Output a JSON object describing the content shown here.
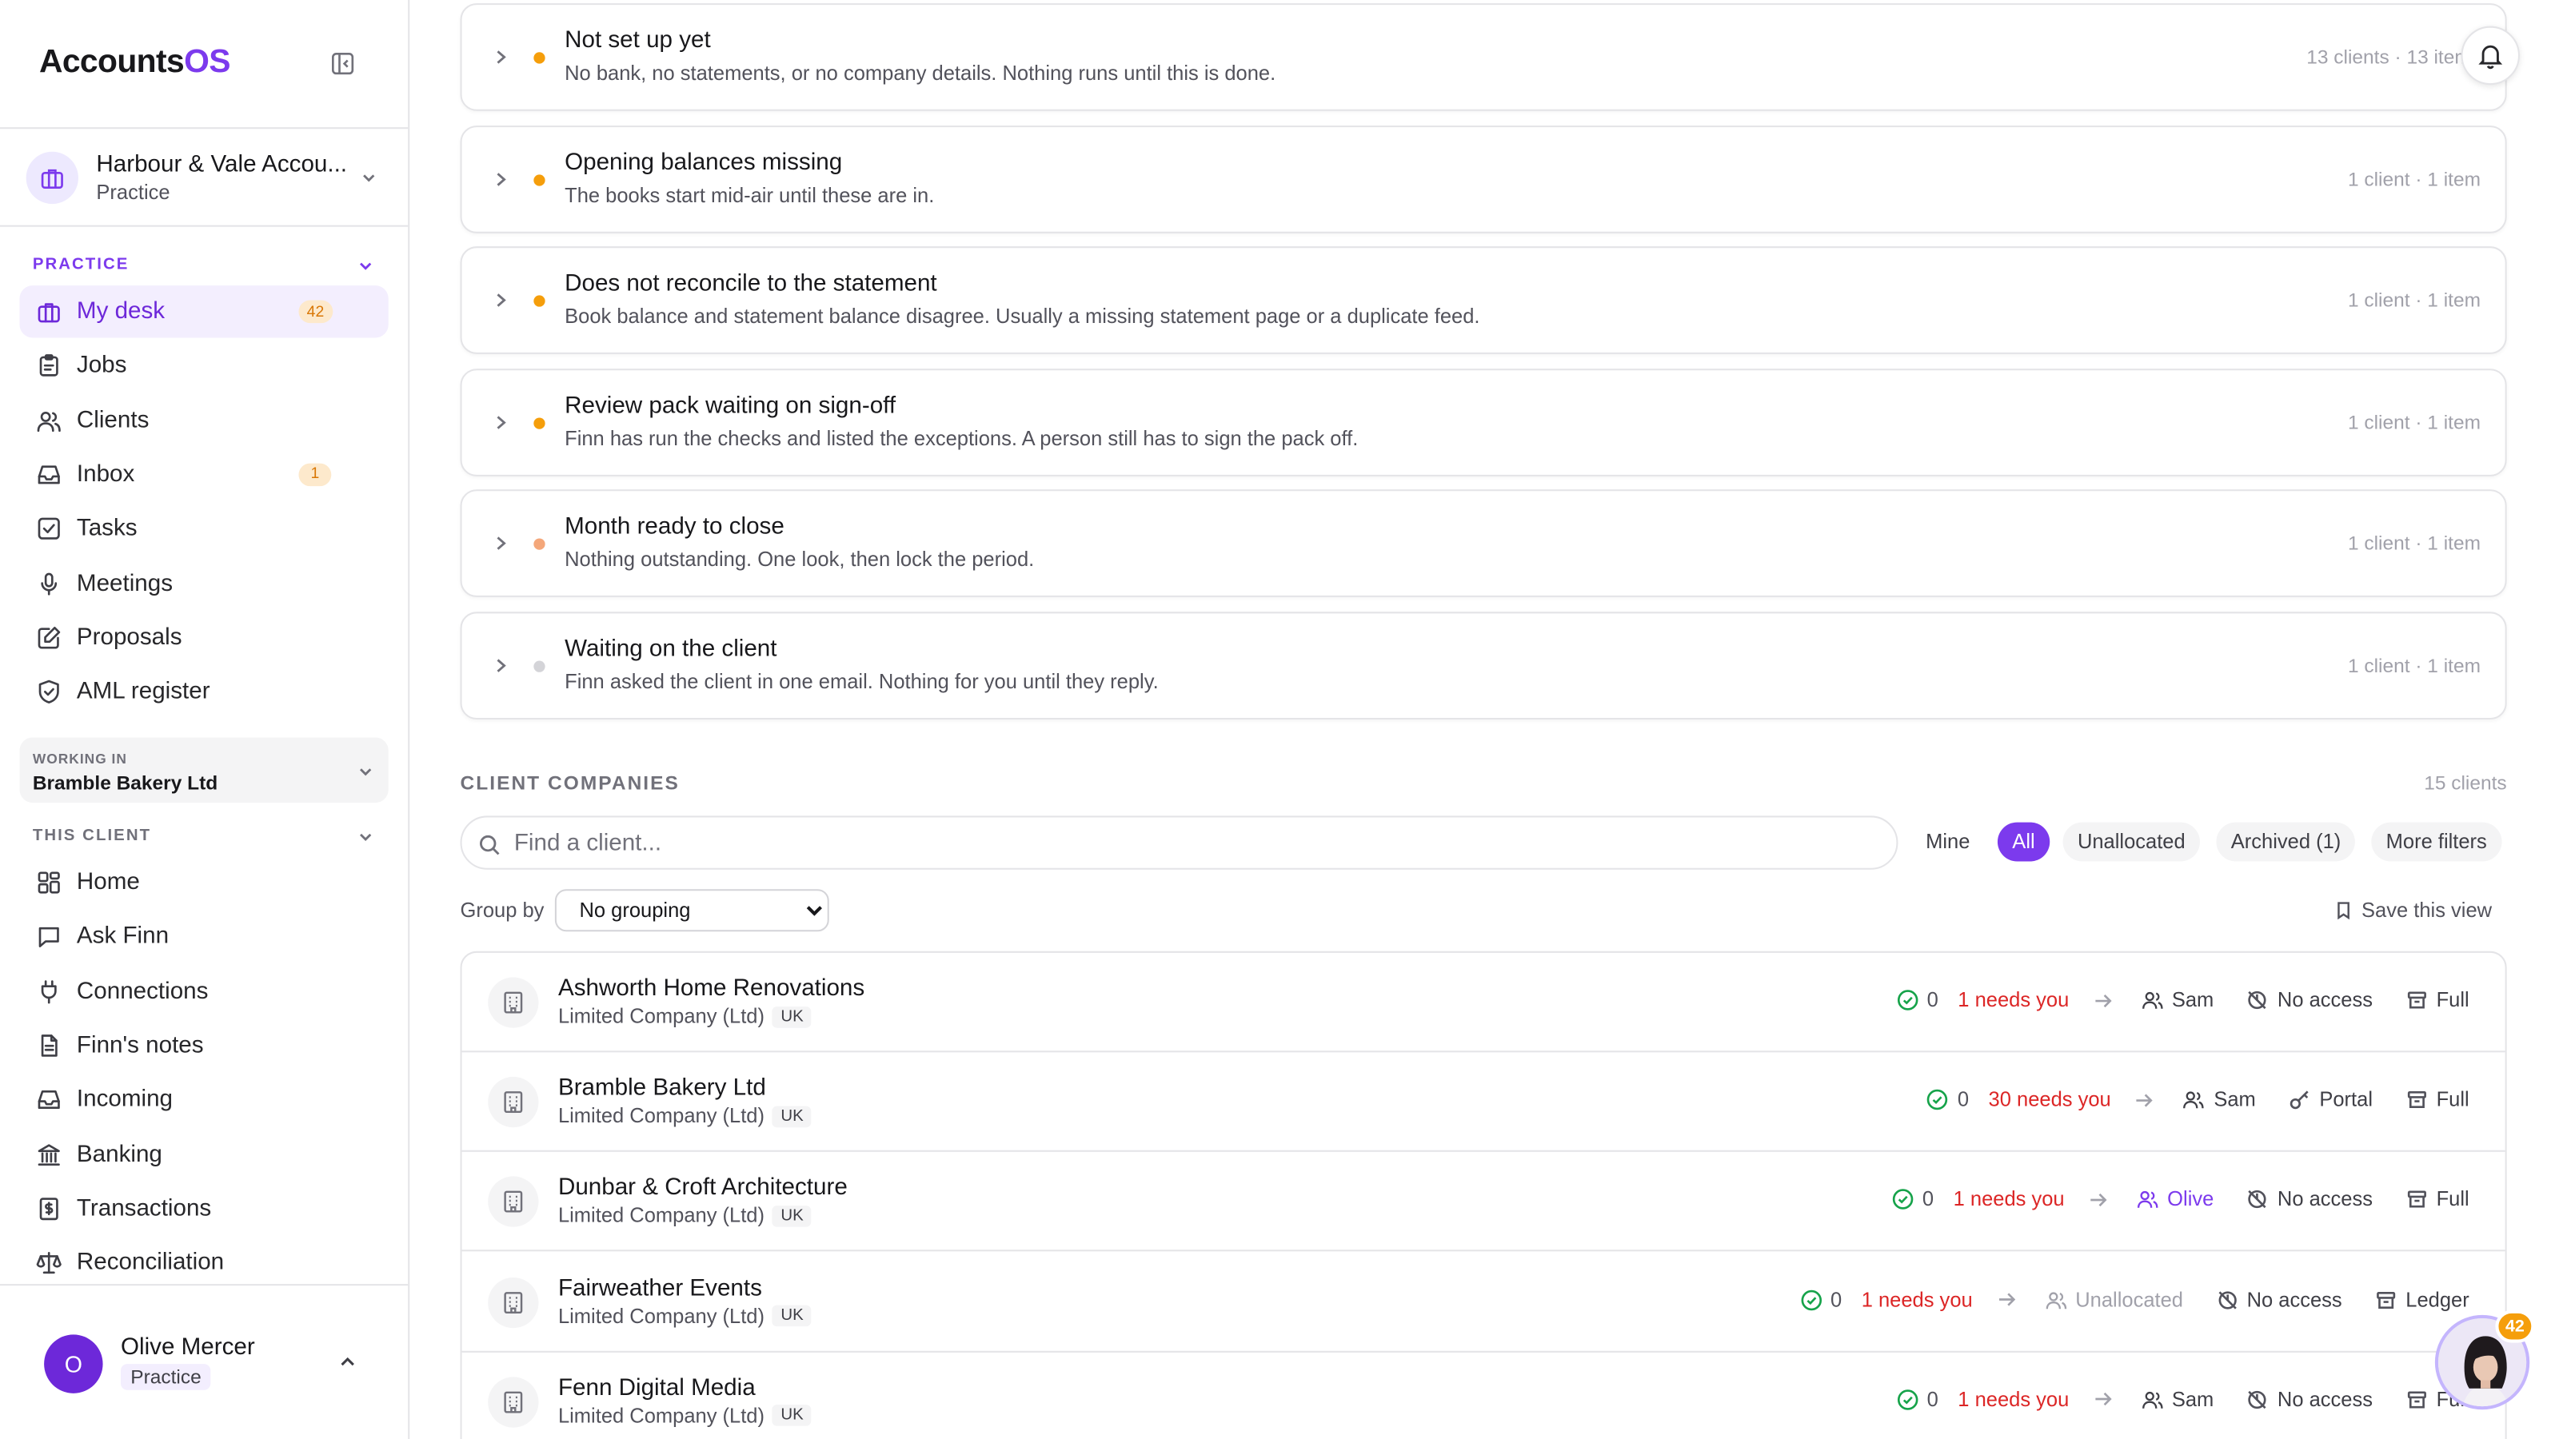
{
  "app": {
    "brand_a": "Accounts",
    "brand_b": "OS"
  },
  "org": {
    "name": "Harbour & Vale Accou...",
    "role": "Practice"
  },
  "practice_section": {
    "label": "PRACTICE"
  },
  "nav_practice": [
    {
      "label": "My desk",
      "badge": "42",
      "icon": "briefcase-icon",
      "active": true
    },
    {
      "label": "Jobs",
      "icon": "clipboard-icon"
    },
    {
      "label": "Clients",
      "icon": "users-icon"
    },
    {
      "label": "Inbox",
      "badge": "1",
      "icon": "inbox-icon"
    },
    {
      "label": "Tasks",
      "icon": "check-square-icon"
    },
    {
      "label": "Meetings",
      "icon": "mic-icon"
    },
    {
      "label": "Proposals",
      "icon": "pen-square-icon"
    },
    {
      "label": "AML register",
      "icon": "shield-check-icon"
    }
  ],
  "working_in": {
    "label": "WORKING IN",
    "value": "Bramble Bakery Ltd"
  },
  "client_section": {
    "label": "THIS CLIENT"
  },
  "nav_client": [
    {
      "label": "Home",
      "icon": "grid-icon"
    },
    {
      "label": "Ask Finn",
      "icon": "message-icon"
    },
    {
      "label": "Connections",
      "icon": "plug-icon"
    },
    {
      "label": "Finn's notes",
      "icon": "file-text-icon"
    },
    {
      "label": "Incoming",
      "icon": "inbox-icon"
    },
    {
      "label": "Banking",
      "icon": "bank-icon"
    },
    {
      "label": "Transactions",
      "icon": "receipt-icon"
    },
    {
      "label": "Reconciliation",
      "icon": "scale-icon"
    }
  ],
  "user": {
    "initial": "O",
    "name": "Olive Mercer",
    "role": "Practice"
  },
  "groups": [
    {
      "title": "Not set up yet",
      "desc": "No bank, no statements, or no company details. Nothing runs until this is done.",
      "meta": "13 clients · 13 items",
      "dot": "#f59e0b"
    },
    {
      "title": "Opening balances missing",
      "desc": "The books start mid-air until these are in.",
      "meta": "1 client · 1 item",
      "dot": "#f59e0b"
    },
    {
      "title": "Does not reconcile to the statement",
      "desc": "Book balance and statement balance disagree. Usually a missing statement page or a duplicate feed.",
      "meta": "1 client · 1 item",
      "dot": "#f59e0b"
    },
    {
      "title": "Review pack waiting on sign-off",
      "desc": "Finn has run the checks and listed the exceptions. A person still has to sign the pack off.",
      "meta": "1 client · 1 item",
      "dot": "#f59e0b"
    },
    {
      "title": "Month ready to close",
      "desc": "Nothing outstanding. One look, then lock the period.",
      "meta": "1 client · 1 item",
      "dot": "#f4a77a"
    },
    {
      "title": "Waiting on the client",
      "desc": "Finn asked the client in one email. Nothing for you until they reply.",
      "meta": "1 client · 1 item",
      "dot": "#d4d4d8"
    }
  ],
  "companies": {
    "title": "CLIENT COMPANIES",
    "count": "15 clients",
    "search_placeholder": "Find a client...",
    "filters": [
      "Mine",
      "All",
      "Unallocated",
      "Archived (1)",
      "More filters"
    ],
    "selected_filter": "All",
    "group_by_label": "Group by",
    "group_by_value": "No grouping",
    "save_view": "Save this view"
  },
  "clients": [
    {
      "name": "Ashworth Home Renovations",
      "type": "Limited Company (Ltd)",
      "country": "UK",
      "done": "0",
      "needs": "1 needs you",
      "owner": "Sam",
      "access": "No access",
      "access_icon": "no-access-icon",
      "scope": "Full"
    },
    {
      "name": "Bramble Bakery Ltd",
      "type": "Limited Company (Ltd)",
      "country": "UK",
      "done": "0",
      "needs": "30 needs you",
      "owner": "Sam",
      "access": "Portal",
      "access_icon": "key-icon",
      "scope": "Full"
    },
    {
      "name": "Dunbar & Croft Architecture",
      "type": "Limited Company (Ltd)",
      "country": "UK",
      "done": "0",
      "needs": "1 needs you",
      "owner": "Olive",
      "access": "No access",
      "access_icon": "no-access-icon",
      "scope": "Full",
      "owner_color": "#7c3aed"
    },
    {
      "name": "Fairweather Events",
      "type": "Limited Company (Ltd)",
      "country": "UK",
      "done": "0",
      "needs": "1 needs you",
      "owner": "Unallocated",
      "access": "No access",
      "access_icon": "no-access-icon",
      "scope": "Ledger",
      "owner_color": "#a1a1aa"
    },
    {
      "name": "Fenn Digital Media",
      "type": "Limited Company (Ltd)",
      "country": "UK",
      "done": "0",
      "needs": "1 needs you",
      "owner": "Sam",
      "access": "No access",
      "access_icon": "no-access-icon",
      "scope": "Full"
    }
  ],
  "assistant": {
    "badge": "42"
  },
  "colors": {
    "accent": "#7c3aed",
    "warning": "#f59e0b",
    "danger": "#dc2626",
    "success": "#16a34a"
  }
}
